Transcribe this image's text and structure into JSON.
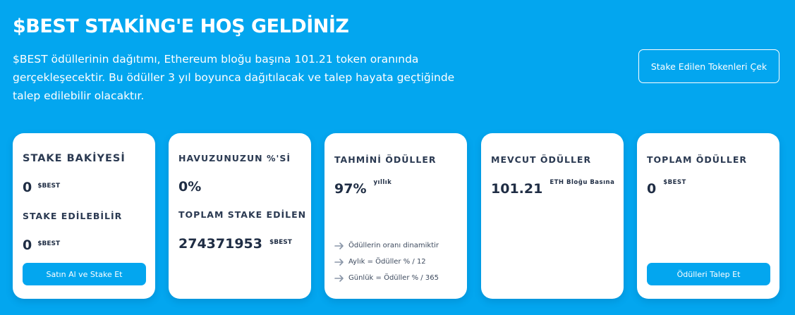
{
  "header": {
    "title": "$BEST STAKİNG'E HOŞ GELDİNİZ",
    "intro": "$BEST ödüllerinin dağıtımı, Ethereum bloğu başına 101.21 token oranında gerçekleşecektir. Bu ödüller 3 yıl boyunca dağıtılacak ve talep hayata geçtiğinde talep edilebilir olacaktır.",
    "withdraw_label": "Stake Edilen Tokenleri Çek"
  },
  "cards": {
    "balance": {
      "label": "STAKE BAKİYESİ",
      "value": "0",
      "unit": "$BEST",
      "label2": "STAKE EDİLEBİLİR",
      "value2": "0",
      "unit2": "$BEST",
      "button_label": "Satın Al ve Stake Et"
    },
    "pool": {
      "label": "HAVUZUNUZUN %'Sİ",
      "value": "0%",
      "label2": "TOPLAM STAKE EDİLEN",
      "value2": "274371953",
      "unit2": "$BEST"
    },
    "estimated": {
      "label": "TAHMİNİ ÖDÜLLER",
      "value": "97%",
      "suffix": "yıllık",
      "notes": [
        "Ödüllerin oranı dinamiktir",
        "Aylık = Ödüller % / 12",
        "Günlük = Ödüller % / 365"
      ]
    },
    "current": {
      "label": "MEVCUT ÖDÜLLER",
      "value": "101.21",
      "suffix": "ETH Bloğu Basına"
    },
    "total": {
      "label": "TOPLAM ÖDÜLLER",
      "value": "0",
      "suffix": "$BEST",
      "button_label": "Ödülleri Talep Et"
    }
  },
  "colors": {
    "background": "#03a6ef",
    "card": "#ffffff",
    "button": "#03a6ef",
    "text_dark": "#2b3a52"
  },
  "icons": {
    "note_bullet": "arrow-right-icon"
  }
}
